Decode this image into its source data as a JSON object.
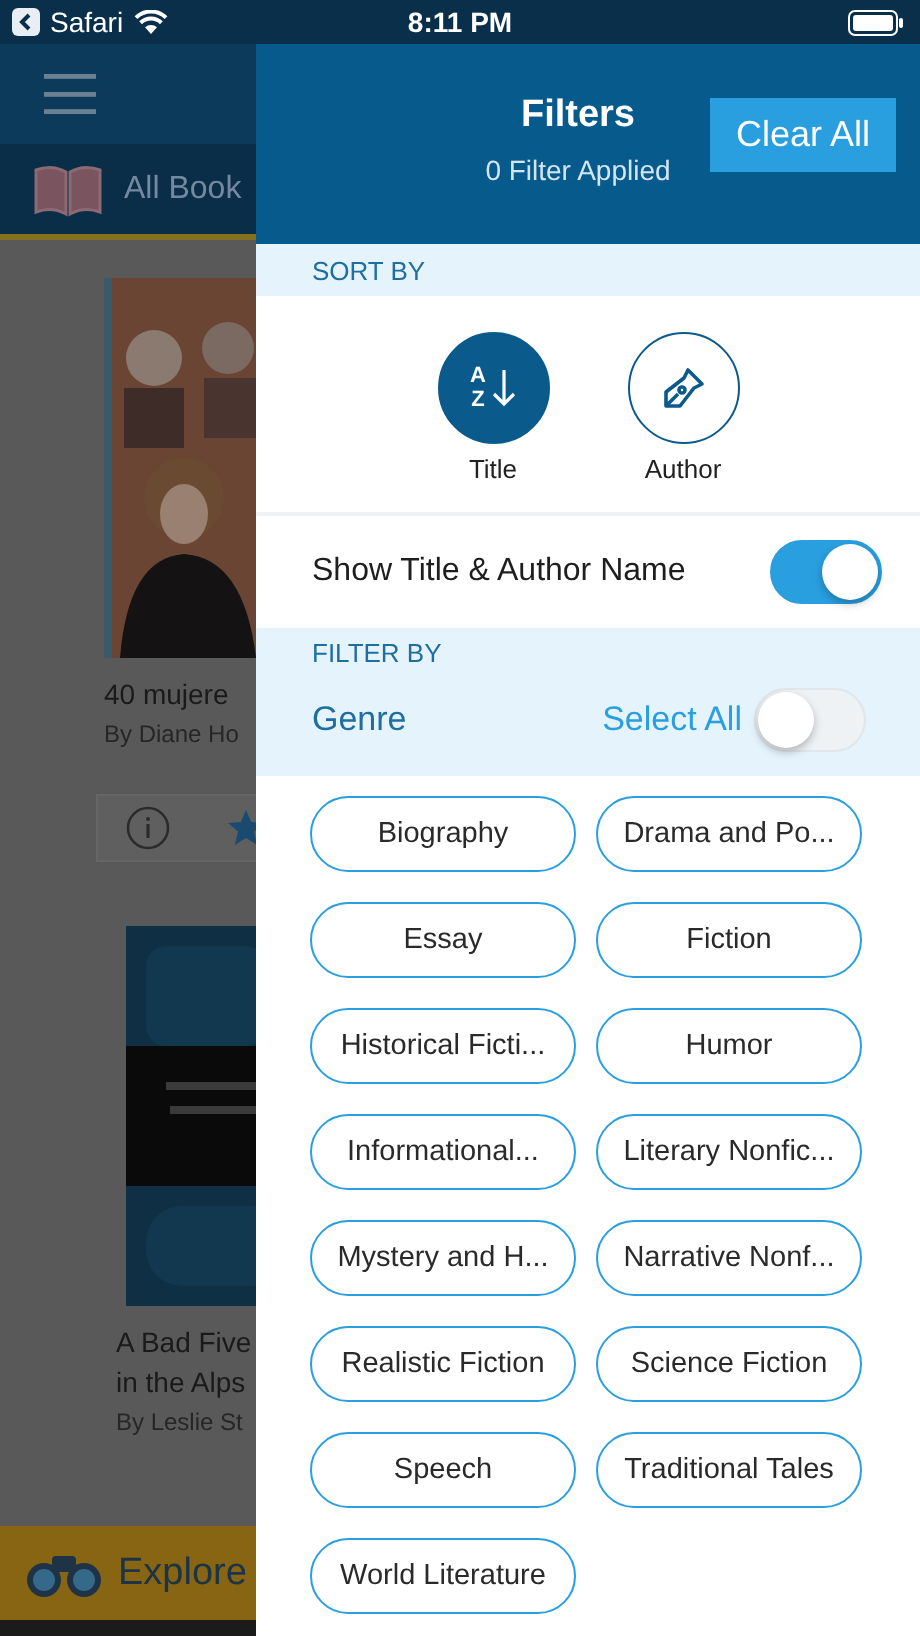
{
  "status_bar": {
    "back_app": "Safari",
    "time": "8:11 PM"
  },
  "background_app": {
    "tab": "All Book",
    "books": [
      {
        "title_lines": [
          "40 mujere"
        ],
        "author": "By Diane Ho"
      },
      {
        "title_lines": [
          "A Bad Five",
          "in the Alps"
        ],
        "author": "By Leslie St"
      }
    ],
    "explore": "Explore"
  },
  "filters": {
    "title": "Filters",
    "subtitle": "0 Filter Applied",
    "clear_button": "Clear All",
    "sort_heading": "SORT BY",
    "sort_options": [
      {
        "label": "Title",
        "kind": "alpha",
        "letters": [
          "A",
          "Z"
        ],
        "selected": true
      },
      {
        "label": "Author",
        "kind": "pen",
        "selected": false
      }
    ],
    "show_names": {
      "label": "Show Title & Author Name",
      "on": true
    },
    "filter_heading": "FILTER BY",
    "genre": {
      "label": "Genre",
      "select_all": "Select All",
      "on": false
    },
    "genres": [
      {
        "label": "Biography",
        "selected": false
      },
      {
        "label": "Drama and Po...",
        "selected": false
      },
      {
        "label": "Essay",
        "selected": false
      },
      {
        "label": "Fiction",
        "selected": false
      },
      {
        "label": "Historical Ficti...",
        "selected": false
      },
      {
        "label": "Humor",
        "selected": false
      },
      {
        "label": "Informational...",
        "selected": false
      },
      {
        "label": "Literary Nonfic...",
        "selected": false
      },
      {
        "label": "Mystery and H...",
        "selected": false
      },
      {
        "label": "Narrative Nonf...",
        "selected": false
      },
      {
        "label": "Realistic Fiction",
        "selected": false
      },
      {
        "label": "Science Fiction",
        "selected": false
      },
      {
        "label": "Speech",
        "selected": false
      },
      {
        "label": "Traditional Tales",
        "selected": false
      },
      {
        "label": "World Literature",
        "selected": false
      }
    ]
  }
}
